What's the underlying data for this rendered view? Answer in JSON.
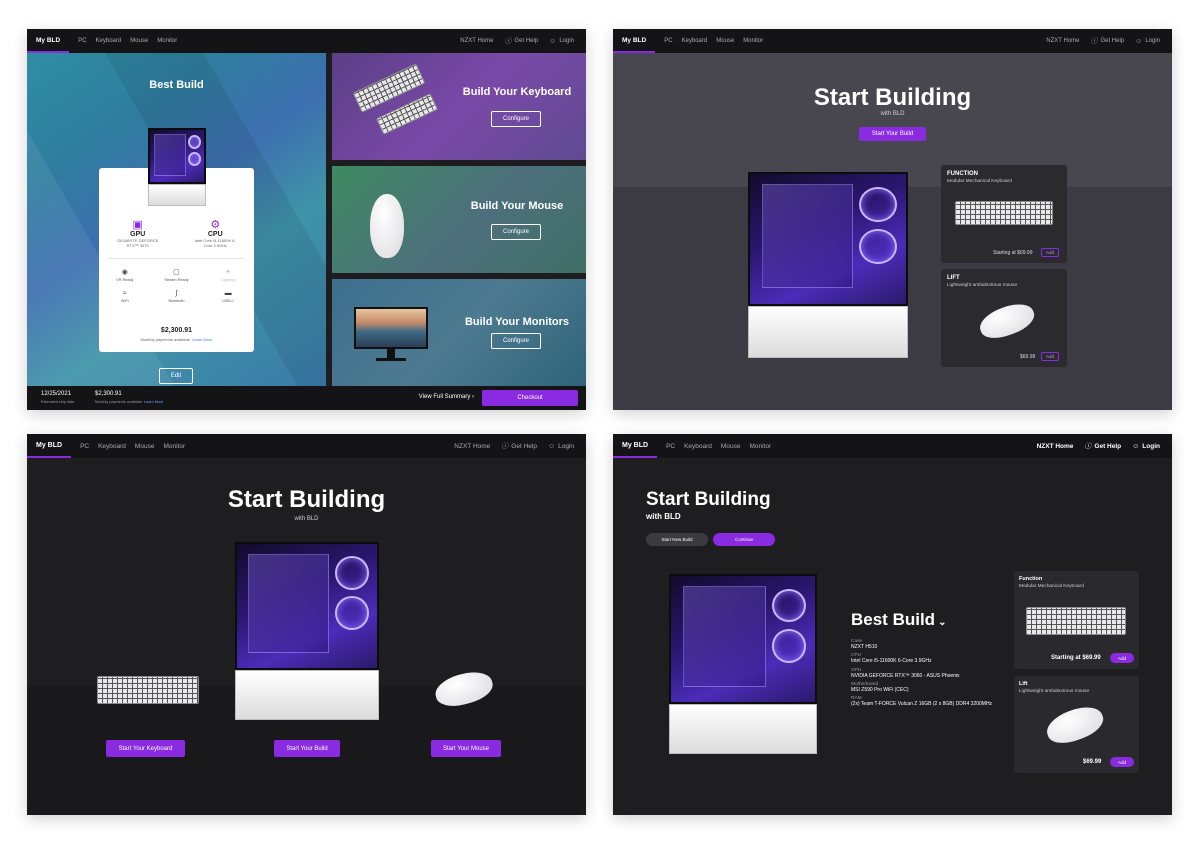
{
  "nav": {
    "brand": "My BLD",
    "links": [
      "PC",
      "Keyboard",
      "Mouse",
      "Monitor"
    ],
    "right": [
      "NZXT Home",
      "Get Help",
      "Login"
    ]
  },
  "panel1": {
    "best_build_title": "Best Build",
    "gpu_label": "GPU",
    "gpu_value": "GIGABYTE GEFORCE RTX™ 3070",
    "cpu_label": "CPU",
    "cpu_value": "Intel Core i5-11600K 6-Core 3.9GHz",
    "features": [
      "VR Ready",
      "Stream Ready",
      "Lighting",
      "WiFi",
      "Bluetooth",
      "USB-C"
    ],
    "price": "$2,300.91",
    "payments_text": "Monthly payments available.",
    "learn_more": "Learn More",
    "edit_label": "Edit",
    "keyboard_title": "Build Your Keyboard",
    "mouse_title": "Build Your Mouse",
    "monitor_title": "Build Your Monitors",
    "configure_label": "Configure",
    "footer": {
      "date": "12/25/2021",
      "date_label": "Estimated ship date",
      "price": "$2,300.91",
      "payments_text": "Monthly payments available.",
      "learn_more": "Learn More",
      "view_summary": "View Full Summary",
      "checkout": "Checkout"
    }
  },
  "panel2": {
    "title": "Start Building",
    "subtitle": "with BLD",
    "start_button": "Start Your Build",
    "cards": [
      {
        "title": "FUNCTION",
        "subtitle": "Modular Mechanical Keyboard",
        "price": "Starting at $69.99",
        "add": "Add"
      },
      {
        "title": "LIFT",
        "subtitle": "Lightweight ambidextrous mouse",
        "price": "$69.99",
        "add": "Add"
      }
    ]
  },
  "panel3": {
    "title": "Start Building",
    "subtitle": "with BLD",
    "buttons": [
      "Start Your Keyboard",
      "Start Your Build",
      "Start Your Mouse"
    ]
  },
  "panel4": {
    "title": "Start Building",
    "subtitle": "with BLD",
    "new_build": "Start New Build",
    "continue": "Continue",
    "best_build": "Best Build",
    "specs": [
      {
        "label": "Case",
        "value": "NZXT H510"
      },
      {
        "label": "CPU",
        "value": "Intel Core i5-11600K 6-Core 3.9GHz"
      },
      {
        "label": "GPU",
        "value": "NVIDIA GEFORCE RTX™ 3060 - ASUS Phoenix"
      },
      {
        "label": "Motherboard",
        "value": "MSI Z590 Pro WiFi (CEC)"
      },
      {
        "label": "RAM",
        "value": "(2x) Team T-FORCE Vulcan Z 16GB (2 x 8GB) DDR4 3200MHz"
      }
    ],
    "cards": [
      {
        "title": "Function",
        "subtitle": "Modular Mechanical Keyboard",
        "price": "Starting at $69.99",
        "add": "Add"
      },
      {
        "title": "Lift",
        "subtitle": "Lightweight ambidextrous mouse",
        "price": "$69.99",
        "add": "Add"
      }
    ]
  },
  "colors": {
    "accent": "#8a2be2",
    "nav_bg": "#141416"
  },
  "icons": [
    "help-icon",
    "user-icon",
    "gpu-icon",
    "cpu-icon",
    "vr-icon",
    "stream-icon",
    "lighting-icon",
    "wifi-icon",
    "bluetooth-icon",
    "usb-c-icon",
    "chevron-right-icon",
    "chevron-down-icon"
  ]
}
